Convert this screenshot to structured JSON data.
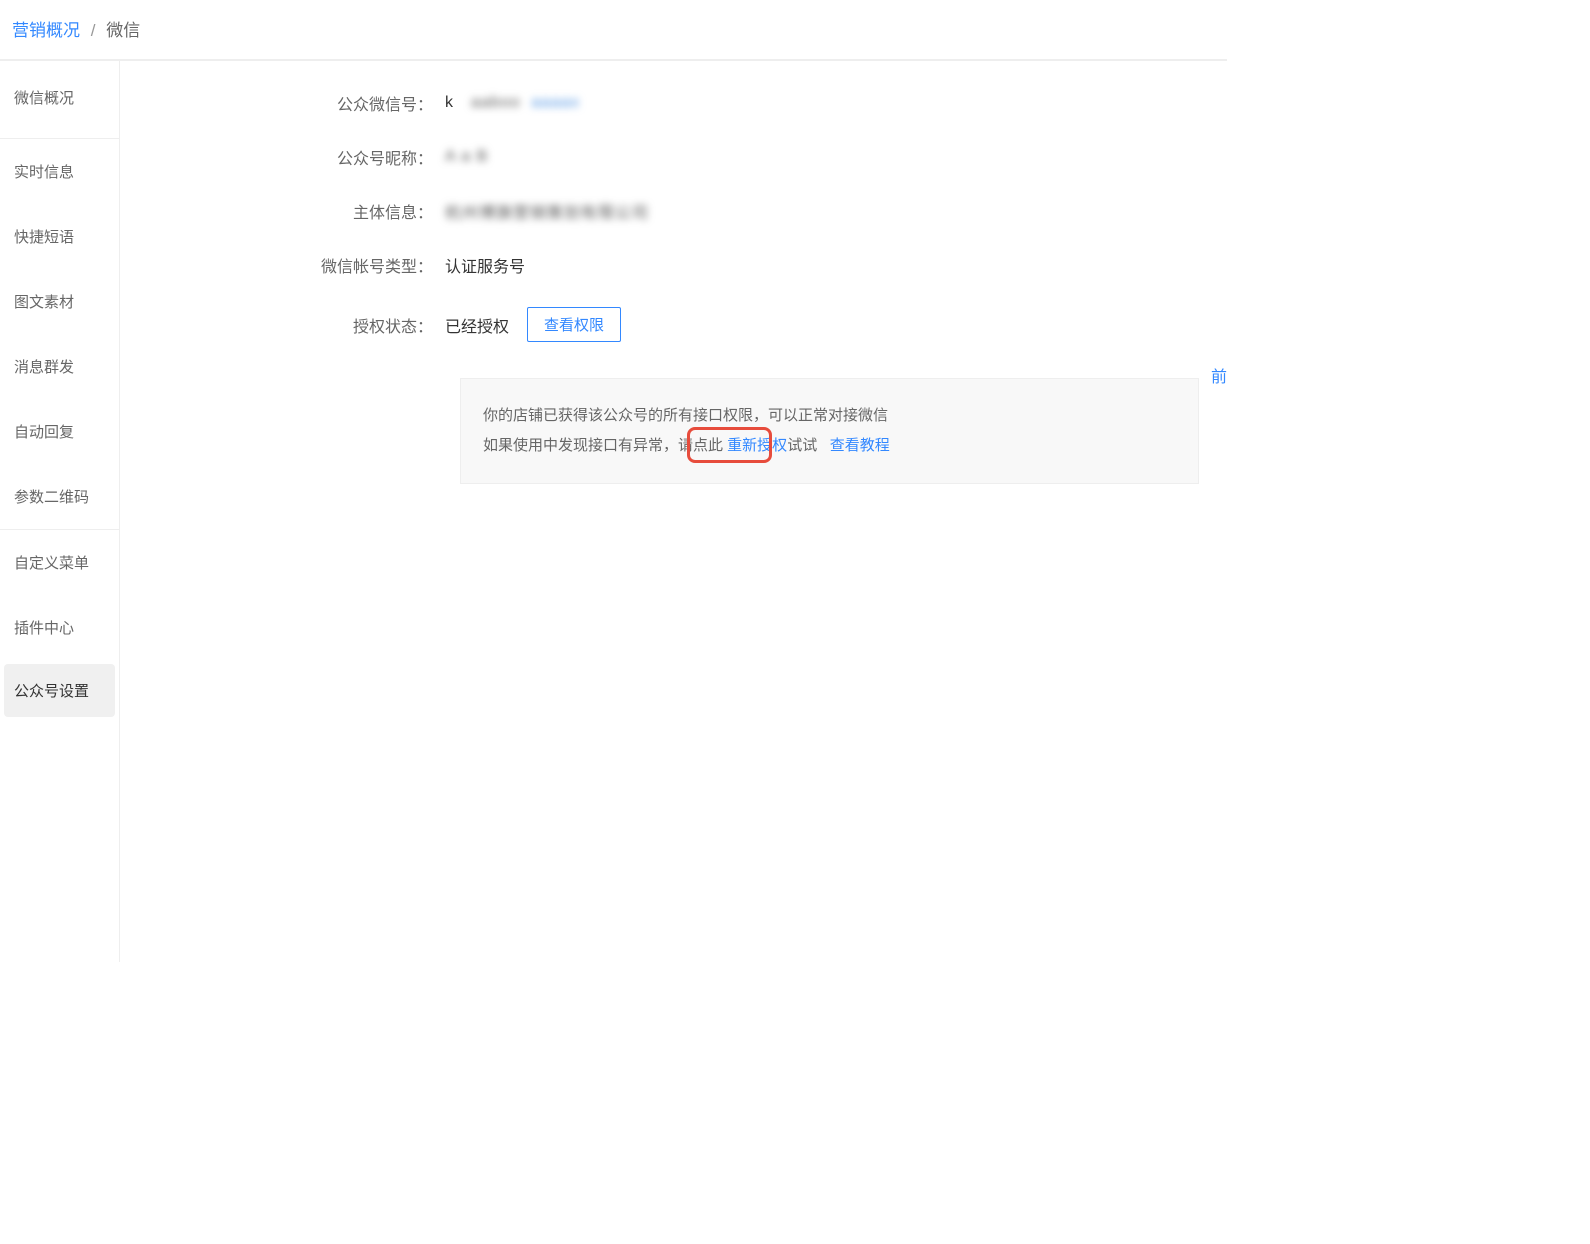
{
  "breadcrumb": {
    "link": "营销概况",
    "separator": "/",
    "current": "微信"
  },
  "sidebar": {
    "group1": [
      {
        "label": "微信概况"
      }
    ],
    "group2": [
      {
        "label": "实时信息"
      },
      {
        "label": "快捷短语"
      },
      {
        "label": "图文素材"
      },
      {
        "label": "消息群发"
      },
      {
        "label": "自动回复"
      },
      {
        "label": "参数二维码"
      }
    ],
    "group3": [
      {
        "label": "自定义菜单"
      },
      {
        "label": "插件中心"
      },
      {
        "label": "公众号设置",
        "active": true
      }
    ]
  },
  "form": {
    "wechat_id_label": "公众微信号：",
    "wechat_id_value_prefix": "k",
    "wechat_id_masked_1": "aaboo",
    "wechat_id_masked_2": "aaaax",
    "nickname_label": "公众号昵称：",
    "nickname_masked": "A  a B",
    "entity_label": "主体信息：",
    "entity_masked": "杭州博旗营销策划有限公司",
    "account_type_label": "微信帐号类型：",
    "account_type_value": "认证服务号",
    "auth_status_label": "授权状态：",
    "auth_status_value": "已经授权",
    "view_permissions_btn": "查看权限"
  },
  "info_box": {
    "line1": "你的店铺已获得该公众号的所有接口权限，可以正常对接微信",
    "line2_before": "如果使用中发现接口有异常，请点此 ",
    "reauth_link": "重新授权",
    "line2_after": "试试",
    "tutorial_link": "查看教程"
  },
  "right_cut": "前"
}
